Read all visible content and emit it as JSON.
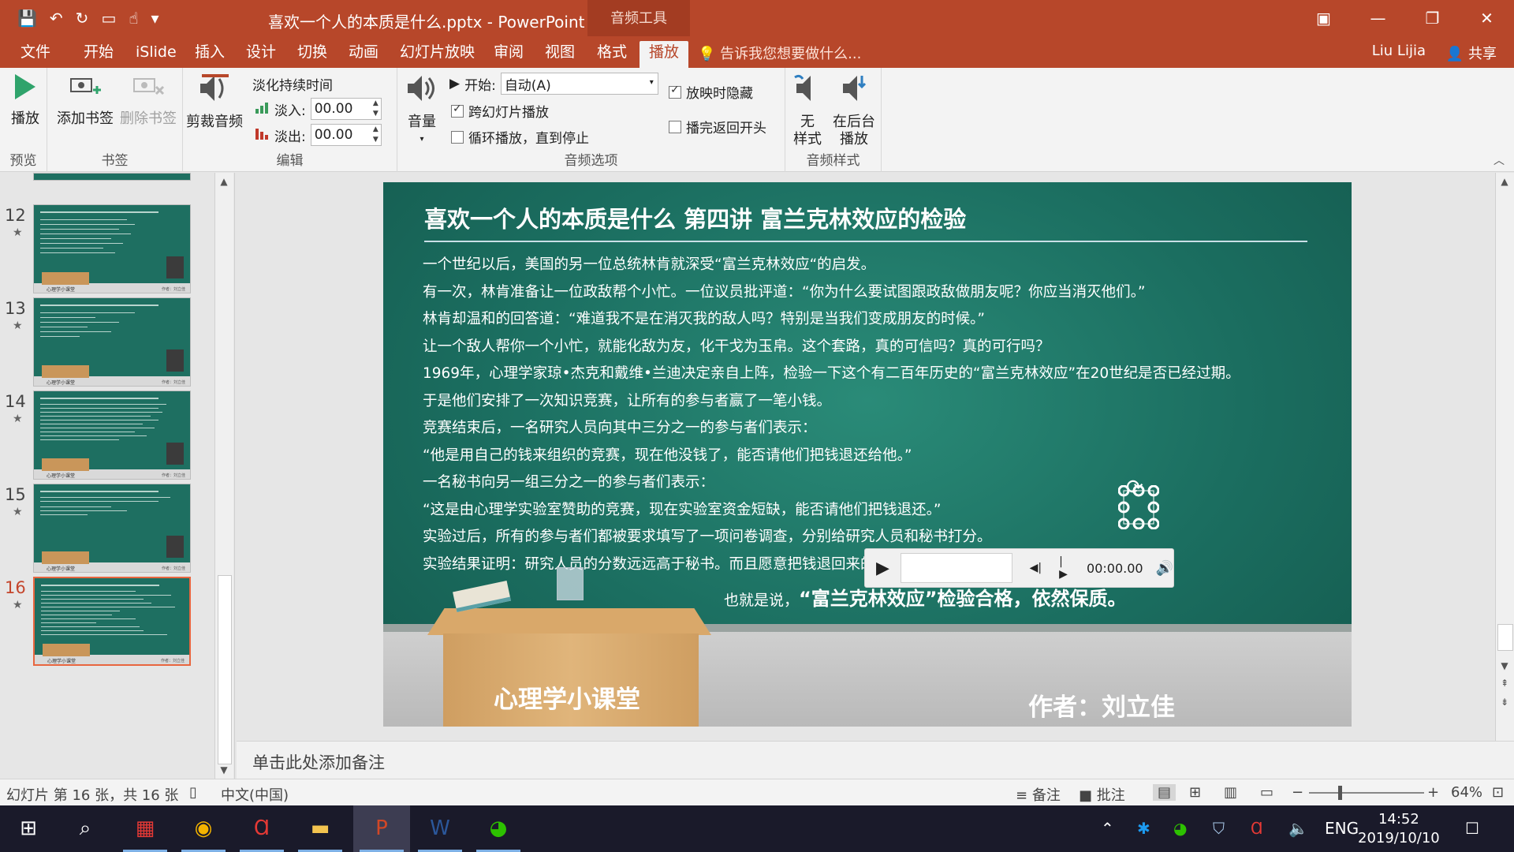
{
  "window": {
    "title": "喜欢一个人的本质是什么.pptx - PowerPoint",
    "context_tab_title": "音频工具",
    "user": "Liu Lijia",
    "share": "共享"
  },
  "tabs": [
    {
      "label": "文件"
    },
    {
      "label": "开始"
    },
    {
      "label": "iSlide"
    },
    {
      "label": "插入"
    },
    {
      "label": "设计"
    },
    {
      "label": "切换"
    },
    {
      "label": "动画"
    },
    {
      "label": "幻灯片放映"
    },
    {
      "label": "审阅"
    },
    {
      "label": "视图"
    },
    {
      "label": "格式"
    },
    {
      "label": "播放"
    }
  ],
  "tell_me": "告诉我您想要做什么...",
  "ribbon": {
    "preview": {
      "play": "播放",
      "group": "预览"
    },
    "bookmarks": {
      "add": "添加书签",
      "delete": "删除书签",
      "group": "书签"
    },
    "editing": {
      "trim": "剪裁音频",
      "fade_title": "淡化持续时间",
      "fade_in_label": "淡入:",
      "fade_in_value": "00.00",
      "fade_out_label": "淡出:",
      "fade_out_value": "00.00",
      "group": "编辑"
    },
    "audio_options": {
      "volume": "音量",
      "start_label": "开始:",
      "start_value": "自动(A)",
      "across_slides": "跨幻灯片播放",
      "loop": "循环播放，直到停止",
      "hide_during_show": "放映时隐藏",
      "rewind": "播完返回开头",
      "group": "音频选项",
      "across_slides_checked": true,
      "loop_checked": false,
      "hide_checked": true,
      "rewind_checked": false
    },
    "audio_styles": {
      "no_style_1": "无",
      "no_style_2": "样式",
      "background_1": "在后台",
      "background_2": "播放",
      "group": "音频样式"
    }
  },
  "thumbnails": [
    {
      "number": "12",
      "footer": "心理学小课堂",
      "author": "作者：刘立佳"
    },
    {
      "number": "13",
      "footer": "心理学小课堂",
      "author": "作者：刘立佳"
    },
    {
      "number": "14",
      "footer": "心理学小课堂",
      "author": "作者：刘立佳"
    },
    {
      "number": "15",
      "footer": "心理学小课堂",
      "author": "作者：刘立佳"
    },
    {
      "number": "16",
      "footer": "心理学小课堂",
      "author": "作者：刘立佳"
    }
  ],
  "slide": {
    "title": "喜欢一个人的本质是什么  第四讲  富兰克林效应的检验",
    "lines": [
      "一个世纪以后，美国的另一位总统林肯就深受“富兰克林效应“的启发。",
      "有一次，林肯准备让一位政敌帮个小忙。一位议员批评道：“你为什么要试图跟政敌做朋友呢？你应当消灭他们。”",
      "林肯却温和的回答道：“难道我不是在消灭我的敌人吗？特别是当我们变成朋友的时候。”",
      "让一个敌人帮你一个小忙，就能化敌为友，化干戈为玉帛。这个套路，真的可信吗？真的可行吗？",
      "1969年，心理学家琼•杰克和戴维•兰迪决定亲自上阵，检验一下这个有二百年历史的“富兰克林效应”在20世纪是否已经过期。",
      "于是他们安排了一次知识竞赛，让所有的参与者赢了一笔小钱。",
      "竞赛结束后，一名研究人员向其中三分之一的参与者们表示：",
      "“他是用自己的钱来组织的竞赛，现在他没钱了，能否请他们把钱退还给他。”",
      "一名秘书向另一组三分之一的参与者们表示：",
      "“这是由心理学实验室赞助的竞赛，现在实验室资金短缺，能否请他们把钱退还。”",
      "实验过后，所有的参与者们都被要求填写了一项问卷调查，分别给研究人员和秘书打分。",
      "实验结果证明：研究人员的分数远远高于秘书。而且愿意把钱退回来的参与者，所给出的分数远远高于不愿意退钱者。"
    ],
    "conclusion_prefix": "也就是说，",
    "conclusion_main": "“富兰克林效应”检验合格，依然保质。",
    "desk_label": "心理学小课堂",
    "author": "作者：刘立佳",
    "player_time": "00:00.00"
  },
  "notes_placeholder": "单击此处添加备注",
  "status": {
    "slide_info": "幻灯片 第 16 张，共 16 张",
    "language": "中文(中国)",
    "notes": "备注",
    "comments": "批注",
    "zoom": "64%"
  },
  "taskbar": {
    "lang": "ENG",
    "time": "14:52",
    "date": "2019/10/10"
  },
  "colors": {
    "accent": "#b7472a",
    "slide_green": "#1b6e60",
    "taskbar": "#1a1a2a"
  }
}
